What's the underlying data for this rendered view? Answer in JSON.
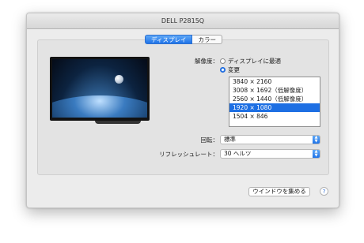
{
  "window": {
    "title": "DELL P2815Q"
  },
  "tabs": [
    {
      "label": "ディスプレイ",
      "active": true
    },
    {
      "label": "カラー",
      "active": false
    }
  ],
  "resolution": {
    "label": "解像度：",
    "options": {
      "default": "ディスプレイに最適",
      "scaled": "変更"
    },
    "selected_option": "scaled",
    "list": [
      {
        "label": "3840 × 2160",
        "selected": false
      },
      {
        "label": "3008 × 1692（低解像度）",
        "selected": false
      },
      {
        "label": "2560 × 1440（低解像度）",
        "selected": false
      },
      {
        "label": "1920 × 1080",
        "selected": true
      },
      {
        "label": "1504 × 846",
        "selected": false
      }
    ]
  },
  "rotation": {
    "label": "回転：",
    "value": "標準"
  },
  "refresh": {
    "label": "リフレッシュレート：",
    "value": "30 ヘルツ"
  },
  "buttons": {
    "gather_windows": "ウインドウを集める",
    "help": "?"
  },
  "colors": {
    "accent": "#1d6fe3"
  }
}
